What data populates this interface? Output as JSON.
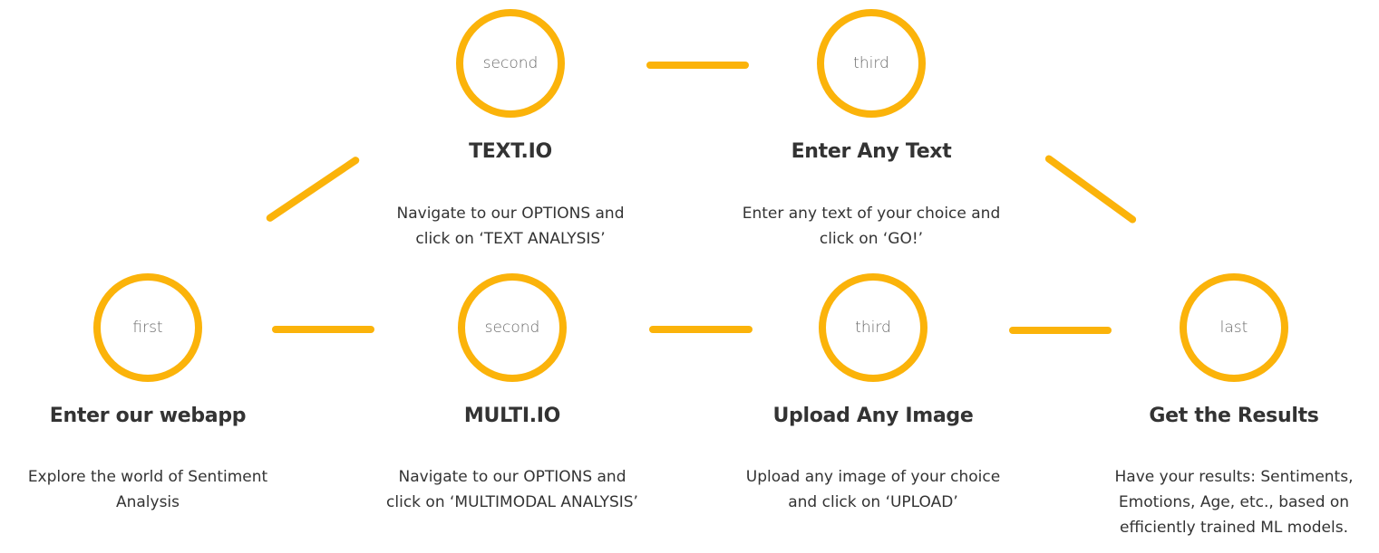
{
  "steps": {
    "first": {
      "circle": "first",
      "title": "Enter our webapp",
      "desc": "Explore the world of Sentiment Analysis"
    },
    "second_text": {
      "circle": "second",
      "title": "TEXT.IO",
      "desc": "Navigate to our OPTIONS and click on ‘TEXT ANALYSIS’"
    },
    "third_text": {
      "circle": "third",
      "title": "Enter Any Text",
      "desc": "Enter any text of your choice and click on ‘GO!’"
    },
    "second_multi": {
      "circle": "second",
      "title": "MULTI.IO",
      "desc": "Navigate to our OPTIONS and click on ‘MULTIMODAL ANALYSIS’"
    },
    "third_multi": {
      "circle": "third",
      "title": "Upload Any Image",
      "desc": "Upload any image of your choice and click on ‘UPLOAD’"
    },
    "last": {
      "circle": "last",
      "title": "Get the Results",
      "desc": "Have your results: Sentiments, Emotions, Age, etc., based on efficiently trained ML models."
    }
  },
  "colors": {
    "accent": "#FBB30A",
    "text": "#333333",
    "circle_label": "#6b6b6b"
  }
}
